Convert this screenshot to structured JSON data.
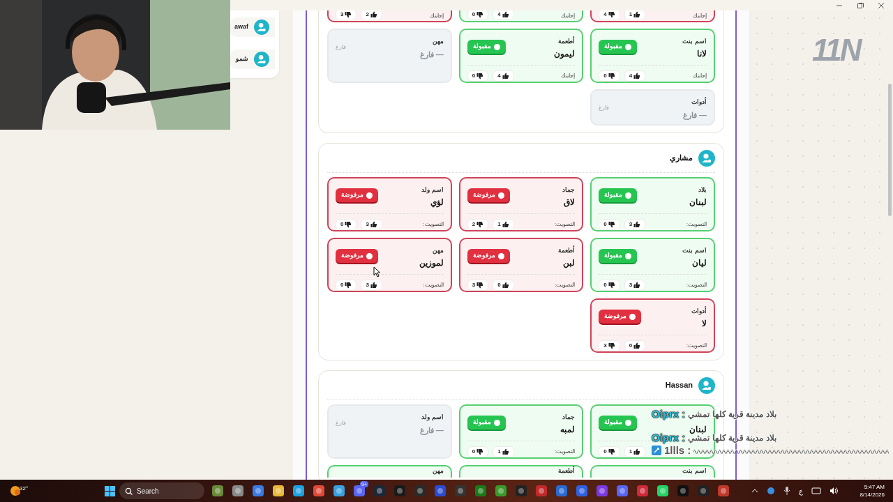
{
  "logo": "11N",
  "sidebar": {
    "items": [
      {
        "name": "awaf"
      },
      {
        "name": "شمو"
      }
    ]
  },
  "sections": [
    {
      "cards": [
        {
          "kind": "partial",
          "accepted": false,
          "vote_label": "إجابتك",
          "likes": "1",
          "dislikes": "4"
        },
        {
          "kind": "partial",
          "accepted": true,
          "vote_label": "إجابتك",
          "likes": "4",
          "dislikes": "0"
        },
        {
          "kind": "partial",
          "accepted": false,
          "vote_label": "إجابتك",
          "likes": "2",
          "dislikes": "3"
        },
        {
          "kind": "answer",
          "category": "اسم بنت",
          "answer": "لانا",
          "status": "مقبولة",
          "accepted": true,
          "vote_label": "إجابتك",
          "likes": "4",
          "dislikes": "0"
        },
        {
          "kind": "answer",
          "category": "أطعمة",
          "answer": "ليمون",
          "status": "مقبولة",
          "accepted": true,
          "vote_label": "إجابتك",
          "likes": "4",
          "dislikes": "0"
        },
        {
          "kind": "empty",
          "category": "مهن",
          "value": "— فارغ",
          "tag": "فارغ"
        },
        {
          "kind": "empty",
          "category": "أدوات",
          "value": "— فارغ",
          "tag": "فارغ"
        }
      ]
    },
    {
      "player": "مشاري",
      "cards": [
        {
          "kind": "answer",
          "category": "بلاد",
          "answer": "لبنان",
          "status": "مقبولة",
          "accepted": true,
          "vote_label": "التصويت:",
          "likes": "3",
          "dislikes": "0"
        },
        {
          "kind": "answer",
          "category": "جماد",
          "answer": "لاق",
          "status": "مرفوضة",
          "accepted": false,
          "vote_label": "التصويت:",
          "likes": "1",
          "dislikes": "2"
        },
        {
          "kind": "answer",
          "category": "اسم ولد",
          "answer": "لؤي",
          "status": "مرفوضة",
          "accepted": false,
          "vote_label": "التصويت:",
          "likes": "3",
          "dislikes": "0"
        },
        {
          "kind": "answer",
          "category": "اسم بنت",
          "answer": "ليان",
          "status": "مقبولة",
          "accepted": true,
          "vote_label": "التصويت:",
          "likes": "3",
          "dislikes": "0"
        },
        {
          "kind": "answer",
          "category": "أطعمة",
          "answer": "لبن",
          "status": "مرفوضة",
          "accepted": false,
          "vote_label": "التصويت:",
          "likes": "0",
          "dislikes": "3"
        },
        {
          "kind": "answer",
          "category": "مهن",
          "answer": "لموزين",
          "status": "مرفوضة",
          "accepted": false,
          "vote_label": "التصويت:",
          "likes": "3",
          "dislikes": "0"
        },
        {
          "kind": "answer",
          "category": "أدوات",
          "answer": "لا",
          "status": "مرفوضة",
          "accepted": false,
          "vote_label": "التصويت:",
          "likes": "0",
          "dislikes": "3"
        }
      ]
    },
    {
      "player": "Hassan",
      "cards": [
        {
          "kind": "answer",
          "answer": "لبنان",
          "status": "مقبولة",
          "accepted": true,
          "likes": "1",
          "dislikes": "0"
        },
        {
          "kind": "answer",
          "category": "جماد",
          "answer": "لمبه",
          "status": "مقبولة",
          "accepted": true,
          "vote_label": "التصويت:",
          "likes": "1",
          "dislikes": "0"
        },
        {
          "kind": "empty",
          "category": "اسم ولد",
          "value": "— فارغ",
          "tag": "فارغ"
        },
        {
          "kind": "cut",
          "category": "اسم بنت",
          "accepted": true
        },
        {
          "kind": "cut",
          "category": "أطعمة",
          "accepted": true
        },
        {
          "kind": "cut",
          "category": "مهن",
          "accepted": true
        }
      ]
    }
  ],
  "chat": [
    {
      "kind": "text",
      "user": "Oiprx :",
      "message": "بلاد مدينة قرية كلها تمشي"
    },
    {
      "kind": "text",
      "user": "Oiprx :",
      "message": "بلاد مدينة قرية كلها تمشي"
    },
    {
      "kind": "scribble",
      "user": "1llls :"
    }
  ],
  "taskbar": {
    "weather": "32°",
    "search_label": "Search",
    "badge": "9+",
    "ime": "ع",
    "time": "5:47 AM",
    "date": "8/14/2026"
  }
}
